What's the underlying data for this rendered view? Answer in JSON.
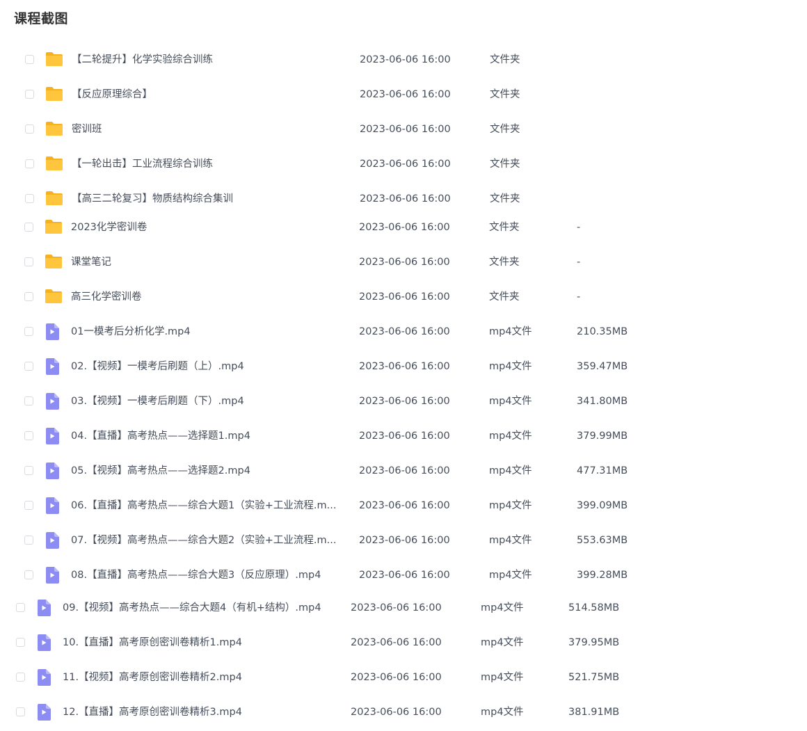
{
  "page": {
    "title": "课程截图"
  },
  "colors": {
    "folder": "#ffc53d",
    "folder_tab": "#f5b120",
    "video": "#8c8cf2",
    "video_play": "#ffffff",
    "text": "#454d5a",
    "checkbox_border": "#d9dbe0"
  },
  "files": [
    {
      "name": "【二轮提升】化学实验综合训练",
      "date": "2023-06-06 16:00",
      "type": "文件夹",
      "size": "",
      "icon": "folder-icon"
    },
    {
      "name": "【反应原理综合】",
      "date": "2023-06-06 16:00",
      "type": "文件夹",
      "size": "",
      "icon": "folder-icon"
    },
    {
      "name": "密训班",
      "date": "2023-06-06 16:00",
      "type": "文件夹",
      "size": "",
      "icon": "folder-icon"
    },
    {
      "name": "【一轮出击】工业流程综合训练",
      "date": "2023-06-06 16:00",
      "type": "文件夹",
      "size": "",
      "icon": "folder-icon"
    },
    {
      "name": "【高三二轮复习】物质结构综合集训",
      "date": "2023-06-06 16:00",
      "type": "文件夹",
      "size": "",
      "icon": "folder-icon"
    },
    {
      "name": "2023化学密训卷",
      "date": "2023-06-06 16:00",
      "type": "文件夹",
      "size": "-",
      "icon": "folder-icon"
    },
    {
      "name": "课堂笔记",
      "date": "2023-06-06 16:00",
      "type": "文件夹",
      "size": "-",
      "icon": "folder-icon"
    },
    {
      "name": "高三化学密训卷",
      "date": "2023-06-06 16:00",
      "type": "文件夹",
      "size": "-",
      "icon": "folder-icon"
    },
    {
      "name": "01一模考后分析化学.mp4",
      "date": "2023-06-06 16:00",
      "type": "mp4文件",
      "size": "210.35MB",
      "icon": "video-file-icon"
    },
    {
      "name": "02.【视频】一模考后刷题（上）.mp4",
      "date": "2023-06-06 16:00",
      "type": "mp4文件",
      "size": "359.47MB",
      "icon": "video-file-icon"
    },
    {
      "name": "03.【视频】一模考后刷题（下）.mp4",
      "date": "2023-06-06 16:00",
      "type": "mp4文件",
      "size": "341.80MB",
      "icon": "video-file-icon"
    },
    {
      "name": "04.【直播】高考热点——选择题1.mp4",
      "date": "2023-06-06 16:00",
      "type": "mp4文件",
      "size": "379.99MB",
      "icon": "video-file-icon"
    },
    {
      "name": "05.【视频】高考热点——选择题2.mp4",
      "date": "2023-06-06 16:00",
      "type": "mp4文件",
      "size": "477.31MB",
      "icon": "video-file-icon"
    },
    {
      "name": "06.【直播】高考热点——综合大题1（实验+工业流程.m...",
      "date": "2023-06-06 16:00",
      "type": "mp4文件",
      "size": "399.09MB",
      "icon": "video-file-icon"
    },
    {
      "name": "07.【视频】高考热点——综合大题2（实验+工业流程.m...",
      "date": "2023-06-06 16:00",
      "type": "mp4文件",
      "size": "553.63MB",
      "icon": "video-file-icon"
    },
    {
      "name": "08.【直播】高考热点——综合大题3（反应原理）.mp4",
      "date": "2023-06-06 16:00",
      "type": "mp4文件",
      "size": "399.28MB",
      "icon": "video-file-icon"
    },
    {
      "name": "09.【视频】高考热点——综合大题4（有机+结构）.mp4",
      "date": "2023-06-06 16:00",
      "type": "mp4文件",
      "size": "514.58MB",
      "icon": "video-file-icon"
    },
    {
      "name": "10.【直播】高考原创密训卷精析1.mp4",
      "date": "2023-06-06 16:00",
      "type": "mp4文件",
      "size": "379.95MB",
      "icon": "video-file-icon"
    },
    {
      "name": "11.【视频】高考原创密训卷精析2.mp4",
      "date": "2023-06-06 16:00",
      "type": "mp4文件",
      "size": "521.75MB",
      "icon": "video-file-icon"
    },
    {
      "name": "12.【直播】高考原创密训卷精析3.mp4",
      "date": "2023-06-06 16:00",
      "type": "mp4文件",
      "size": "381.91MB",
      "icon": "video-file-icon"
    }
  ]
}
